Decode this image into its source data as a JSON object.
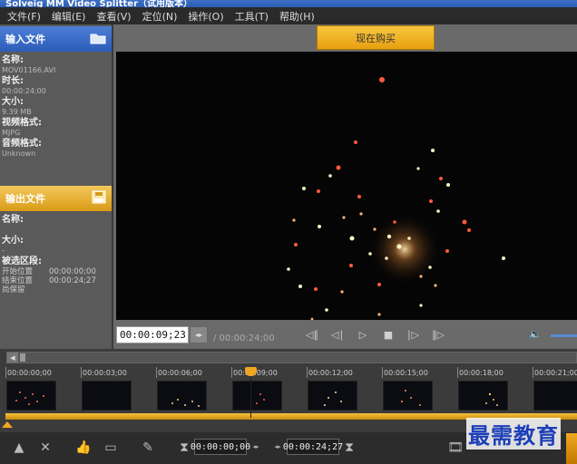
{
  "window": {
    "title": "Solveig MM Video Splitter（试用版本）"
  },
  "menu": [
    {
      "label": "文件(F)"
    },
    {
      "label": "编辑(E)"
    },
    {
      "label": "查看(V)"
    },
    {
      "label": "定位(N)"
    },
    {
      "label": "操作(O)"
    },
    {
      "label": "工具(T)"
    },
    {
      "label": "帮助(H)"
    }
  ],
  "input_panel": {
    "header": "输入文件",
    "name_label": "名称:",
    "name_value": "MOV01166.AVI",
    "duration_label": "时长:",
    "duration_value": "00:00:24;00",
    "size_label": "大小:",
    "size_value": "9.39 MB",
    "video_format_label": "视频格式:",
    "video_format_value": "MJPG",
    "audio_format_label": "音频格式:",
    "audio_format_value": "Unknown"
  },
  "output_panel": {
    "header": "输出文件",
    "name_label": "名称:",
    "size_label": "大小:",
    "size_value": "-",
    "selection_label": "被选区段:",
    "start_label": "开始位置",
    "start_value": "00:00:00;00",
    "end_label": "结束位置",
    "end_value": "00:00:24;27",
    "remaining_label": "尚保留"
  },
  "buy_button": {
    "label": "现在购买"
  },
  "player": {
    "current_time": "00:00:09;23",
    "total_time": "/ 00:00:24;00",
    "volume_level": 0.6
  },
  "timeline": {
    "ticks": [
      "00:00:00;00",
      "00:00:03;00",
      "00:00:06;00",
      "00:00:09;00",
      "00:00:12;00",
      "00:00:15;00",
      "00:00:18;00",
      "00:00:21;00"
    ],
    "playhead_time": "00:00:09;23"
  },
  "toolbar": {
    "start_time": "00:00:00;00",
    "end_time": "00:00:24;27"
  },
  "watermark": {
    "text": "最需教育"
  },
  "colors": {
    "input_header": "#2b5cb8",
    "output_header": "#d99b16",
    "accent": "#f0a820"
  }
}
